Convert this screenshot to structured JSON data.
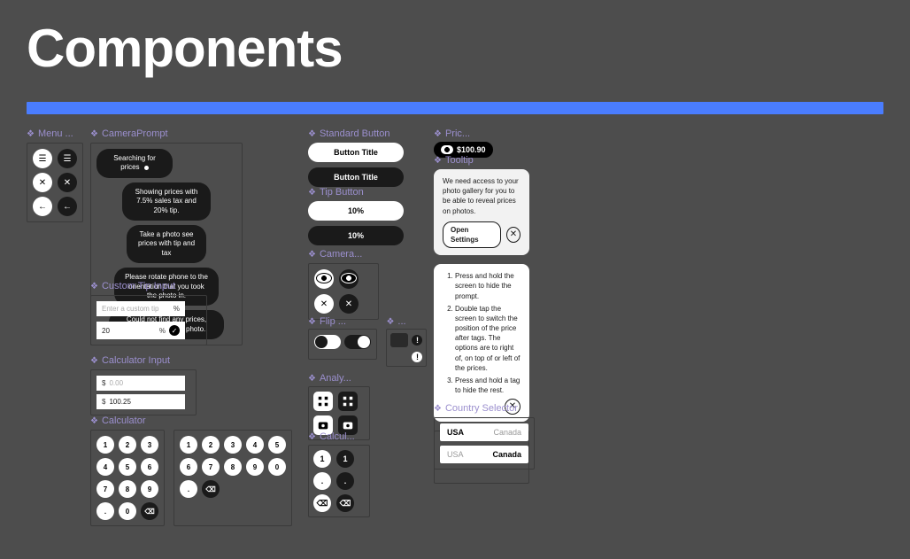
{
  "title": "Components",
  "labels": {
    "menu": "Menu ...",
    "camera_prompt": "CameraPrompt",
    "custom_tip_input": "Custom Tip Input",
    "calculator_input": "Calculator Input",
    "calculator": "Calculator",
    "standard_button": "Standard Button",
    "tip_button": "Tip Button",
    "camera": "Camera...",
    "flip": "Flip ...",
    "ellipsis": "...",
    "analy": "Analy...",
    "calcu": "Calcul...",
    "price": "Pric...",
    "tooltip": "Tooltip",
    "country_selector": "Country Selector"
  },
  "camera_prompts": {
    "searching": "Searching for prices",
    "showing": "Showing prices with 7.5% sales tax and 20% tip.",
    "take_photo": "Take a photo see prices with tip and tax",
    "rotate": "Please rotate phone to the orientation that you took the photo in.",
    "not_found": "Could not find any prices, please try another photo."
  },
  "standard_button": {
    "title": "Button Title"
  },
  "tip_button": {
    "label": "10%"
  },
  "custom_tip": {
    "placeholder": "Enter a custom tip",
    "suffix": "%",
    "value": "20"
  },
  "calculator_input": {
    "currency": "$",
    "placeholder": "0.00",
    "value": "100.25"
  },
  "calculator": {
    "keys_row1": [
      "1",
      "2",
      "3"
    ],
    "keys_row2": [
      "4",
      "5",
      "6"
    ],
    "keys_row3": [
      "7",
      "8",
      "9"
    ],
    "keys_row4": [
      ".",
      "0",
      "⌫"
    ],
    "alt_keys_row1": [
      "1",
      "2",
      "3",
      "4",
      "5"
    ],
    "alt_keys_row2": [
      "6",
      "7",
      "8",
      "9",
      "0"
    ],
    "alt_keys_row3": [
      ".",
      "⌫"
    ]
  },
  "mini_calc": {
    "k1": "1",
    "k2": "1",
    "k3": ".",
    "k4": ".",
    "k5": "⌫",
    "k6": "⌫"
  },
  "price_badge": {
    "value": "$100.90"
  },
  "tooltip1": {
    "body": "We need access to your photo gallery for you to be able to reveal prices on photos.",
    "action": "Open Settings"
  },
  "tooltip2": {
    "item1": "Press and hold the screen to hide the prompt.",
    "item2": "Double tap the screen to switch the position of the price after tags. The options are to right of, on top of or left of the prices.",
    "item3": "Press and hold a tag to hide the rest."
  },
  "country": {
    "usa": "USA",
    "canada": "Canada"
  }
}
